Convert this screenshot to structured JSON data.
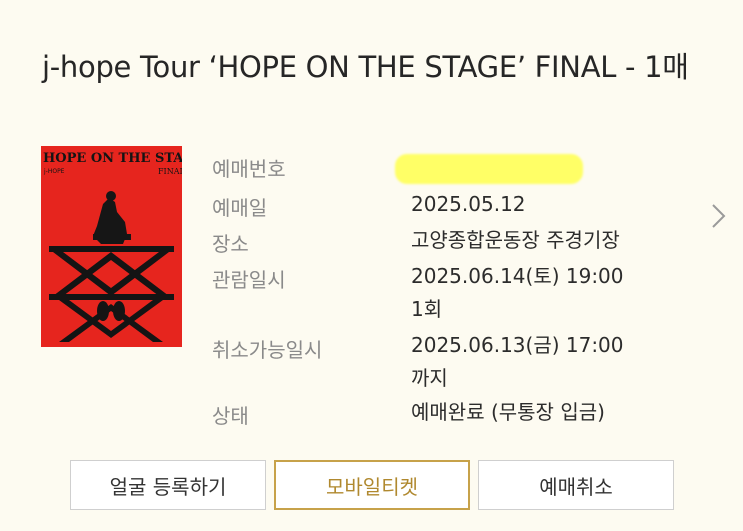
{
  "title": "j-hope Tour ‘HOPE ON THE STAGE’ FINAL - 1매",
  "poster": {
    "headline": "HOPE ON THE STAGE",
    "artist": "j-HOPE",
    "tag": "FINAL",
    "colors": {
      "background": "#e6251e",
      "ink": "#141414"
    }
  },
  "details": [
    {
      "label": "예매번호",
      "value": ""
    },
    {
      "label": "예매일",
      "value": "2025.05.12"
    },
    {
      "label": "장소",
      "value": "고양종합운동장 주경기장"
    },
    {
      "label": "관람일시",
      "value": "2025.06.14(토) 19:00",
      "value2": "1회"
    },
    {
      "label": "취소가능일시",
      "value": "2025.06.13(금) 17:00",
      "value2": "까지"
    },
    {
      "label": "상태",
      "value": "예매완료 (무통장 입금)"
    }
  ],
  "buttons": {
    "face_register": "얼굴 등록하기",
    "mobile_ticket": "모바일티켓",
    "cancel_booking": "예매취소"
  },
  "colors": {
    "page_bg": "#fdfbf1",
    "accent": "#c7a24a",
    "redaction_highlight": "#ffff66"
  }
}
